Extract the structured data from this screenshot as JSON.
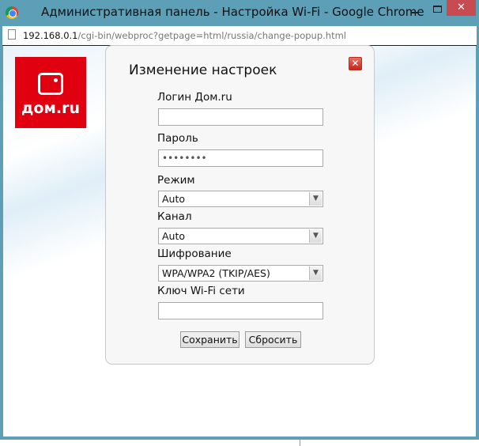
{
  "window": {
    "title": "Административная панель - Настройка Wi-Fi - Google Chrome",
    "close": "✕"
  },
  "address": {
    "host": "192.168.0.1",
    "path": "/cgi-bin/webproc?getpage=html/russia/change-popup.html"
  },
  "logo": {
    "text": "дом.ru",
    "color": "#e1000f"
  },
  "dialog": {
    "title": "Изменение настроек",
    "close": "✕",
    "login_label": "Логин Дом.ru",
    "login_value": "",
    "password_label": "Пароль",
    "password_value": "••••••••",
    "mode_label": "Режим",
    "mode_value": "Auto",
    "channel_label": "Канал",
    "channel_value": "Auto",
    "encryption_label": "Шифрование",
    "encryption_value": "WPA/WPA2 (TKIP/AES)",
    "key_label": "Ключ Wi-Fi сети",
    "key_value": "",
    "save": "Сохранить",
    "reset": "Сбросить"
  }
}
